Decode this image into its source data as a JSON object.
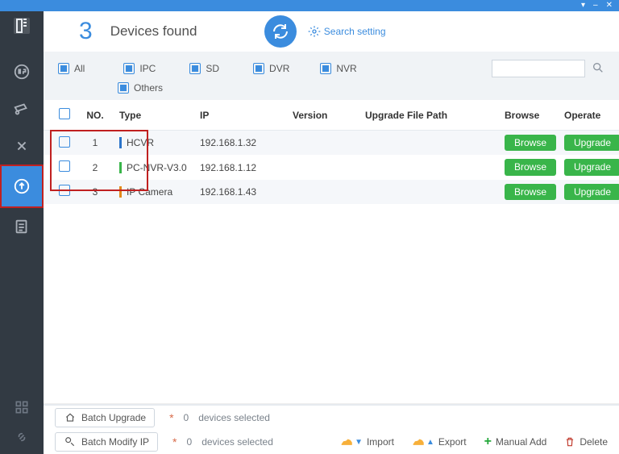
{
  "titlebar": {
    "menu": "▾",
    "min": "–",
    "close": "✕"
  },
  "header": {
    "count": "3",
    "title": "Devices found",
    "search_setting": "Search setting"
  },
  "filters": {
    "all": "All",
    "ipc": "IPC",
    "sd": "SD",
    "dvr": "DVR",
    "nvr": "NVR",
    "others": "Others",
    "search_placeholder": ""
  },
  "columns": {
    "no": "NO.",
    "type": "Type",
    "ip": "IP",
    "version": "Version",
    "path": "Upgrade File Path",
    "browse": "Browse",
    "operate": "Operate"
  },
  "rows": [
    {
      "no": "1",
      "type": "HCVR",
      "bar": "#2b74c9",
      "ip": "192.168.1.32",
      "version": "",
      "path": "",
      "browse": "Browse",
      "operate": "Upgrade"
    },
    {
      "no": "2",
      "type": "PC-NVR-V3.0",
      "bar": "#39b54a",
      "ip": "192.168.1.12",
      "version": "",
      "path": "",
      "browse": "Browse",
      "operate": "Upgrade"
    },
    {
      "no": "3",
      "type": "IP Camera",
      "bar": "#e28a1c",
      "ip": "192.168.1.43",
      "version": "",
      "path": "",
      "browse": "Browse",
      "operate": "Upgrade"
    }
  ],
  "footer": {
    "batch_upgrade": "Batch Upgrade",
    "batch_modify": "Batch Modify IP",
    "selected_count1": "0",
    "selected_text1": "devices selected",
    "selected_count2": "0",
    "selected_text2": "devices selected",
    "import": "Import",
    "export": "Export",
    "manual_add": "Manual Add",
    "delete": "Delete"
  },
  "colors": {
    "accent": "#3b8cde",
    "green": "#39b54a",
    "red_highlight": "#c02020"
  }
}
